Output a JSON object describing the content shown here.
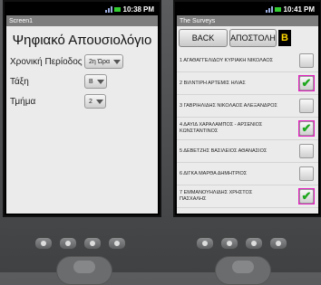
{
  "left_phone": {
    "status_time": "10:38",
    "status_ampm": "PM",
    "window_title": "Screen1",
    "heading": "Ψηφιακό Απουσιολόγιο",
    "fields": [
      {
        "label": "Χρονική Περίοδος",
        "value": "2η Ώρα"
      },
      {
        "label": "Τάξη",
        "value": "Β"
      },
      {
        "label": "Τμήμα",
        "value": "2"
      }
    ]
  },
  "right_phone": {
    "status_time": "10:41",
    "status_ampm": "PM",
    "window_title": "The Surveys",
    "back_label": "BACK",
    "send_label": "ΑΠΟΣΤΟΛΗ",
    "class_badge": "Β",
    "students": [
      {
        "name": "1 ΑΓΑΘΑΓΓΕΛΙΔΟΥ ΚΥΡΙΑΚΗ ΝΙΚΟΛΑΟΣ",
        "checked": false
      },
      {
        "name": "2 ΒΙΛΝΤΙΡΗ ΑΡΤΕΜΙΣ ΗΛΙΑΣ",
        "checked": true
      },
      {
        "name": "3 ΓΑΒΡΙΗΛΙΔΗΣ ΝΙΚΟΛΑΟΣ ΑΛΕΞΑΝΔΡΟΣ",
        "checked": false
      },
      {
        "name": "4 ΔΑΥΙΔ ΧΑΡΑΛΑΜΠΟΣ - ΑΡΣΕΝΙΟΣ ΚΩΝΣΤΑΝΤΙΝΟΣ",
        "checked": true
      },
      {
        "name": "5 ΔΕΒΕΤΖΗΣ ΒΑΣΙΛΕΙΟΣ ΑΘΑΝΑΣΙΟΣ",
        "checked": false
      },
      {
        "name": "6 ΔΙΓΚΑ ΜΑΡΘΑ ΔΗΜΗΤΡΙΟΣ",
        "checked": false
      },
      {
        "name": "7 ΕΜΜΑΝΟΥΗΛΙΔΗΣ ΧΡΗΣΤΟΣ ΠΑΣΧΑΛΗΣ",
        "checked": true
      }
    ]
  },
  "colors": {
    "check_highlight": "#e31fc0",
    "check_mark": "#1ea81e",
    "badge_text": "#ffd800"
  },
  "hardware_icons": [
    "camera-icon",
    "volume-down-icon",
    "volume-up-icon",
    "power-icon"
  ]
}
